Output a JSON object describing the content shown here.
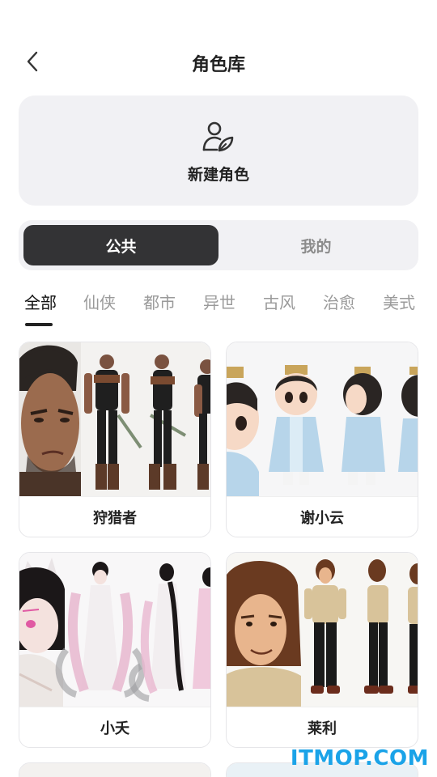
{
  "header": {
    "title": "角色库",
    "back_icon": "chevron-left-icon"
  },
  "create": {
    "label": "新建角色",
    "icon": "user-edit-icon"
  },
  "segment": {
    "active": "公共",
    "inactive": "我的"
  },
  "tabs": [
    "全部",
    "仙侠",
    "都市",
    "异世",
    "古风",
    "治愈",
    "美式"
  ],
  "cards": [
    {
      "name": "狩猎者"
    },
    {
      "name": "谢小云"
    },
    {
      "name": "小夭"
    },
    {
      "name": "莱利"
    }
  ],
  "watermark": "ITMOP.COM"
}
